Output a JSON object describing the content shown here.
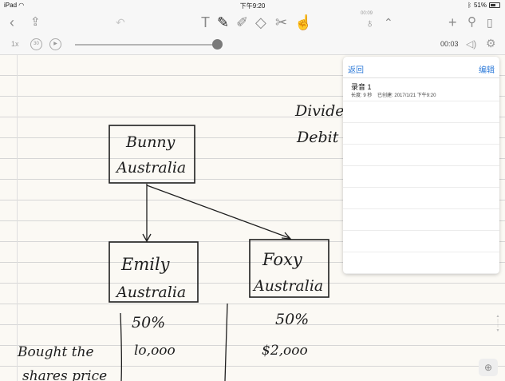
{
  "status_bar": {
    "device": "iPad",
    "wifi_icon": "wifi-icon",
    "time": "下午9:20",
    "bluetooth_icon": "bluetooth-icon",
    "battery": "51%"
  },
  "toolbar": {
    "icons": {
      "back": "chevron-left-icon",
      "share": "share-icon",
      "undo": "undo-icon",
      "text": "text-tool-icon",
      "pen": "pen-icon",
      "highlighter": "highlighter-icon",
      "eraser": "eraser-icon",
      "scissors": "scissors-icon",
      "shape": "shape-icon",
      "mic": "microphone-icon",
      "expand": "chevron-up-icon",
      "add": "plus-icon",
      "wrench": "wrench-icon",
      "pages": "pages-icon"
    },
    "recording_time": "00:09"
  },
  "playback": {
    "speed": "1x",
    "skip_back": "30",
    "current_time": "00:03",
    "progress": 1.0
  },
  "recordings_panel": {
    "back": "返回",
    "edit": "编辑",
    "items": [
      {
        "title": "录音 1",
        "length_label": "长度:",
        "length": "9 秒",
        "created_label": "已创建:",
        "created": "2017/1/21 下午9:20"
      }
    ]
  },
  "note": {
    "box1": [
      "Bunny",
      "Australia"
    ],
    "box2": [
      "Emily",
      "Australia"
    ],
    "box3": [
      "Foxy",
      "Australia"
    ],
    "top_right": [
      "Divider",
      "Debit"
    ],
    "percent_left": "50%",
    "percent_right": "50%",
    "left_text": [
      "Bought the",
      "shares price"
    ],
    "amount_left": "lo,ooo",
    "amount_right": "$2,ooo"
  }
}
